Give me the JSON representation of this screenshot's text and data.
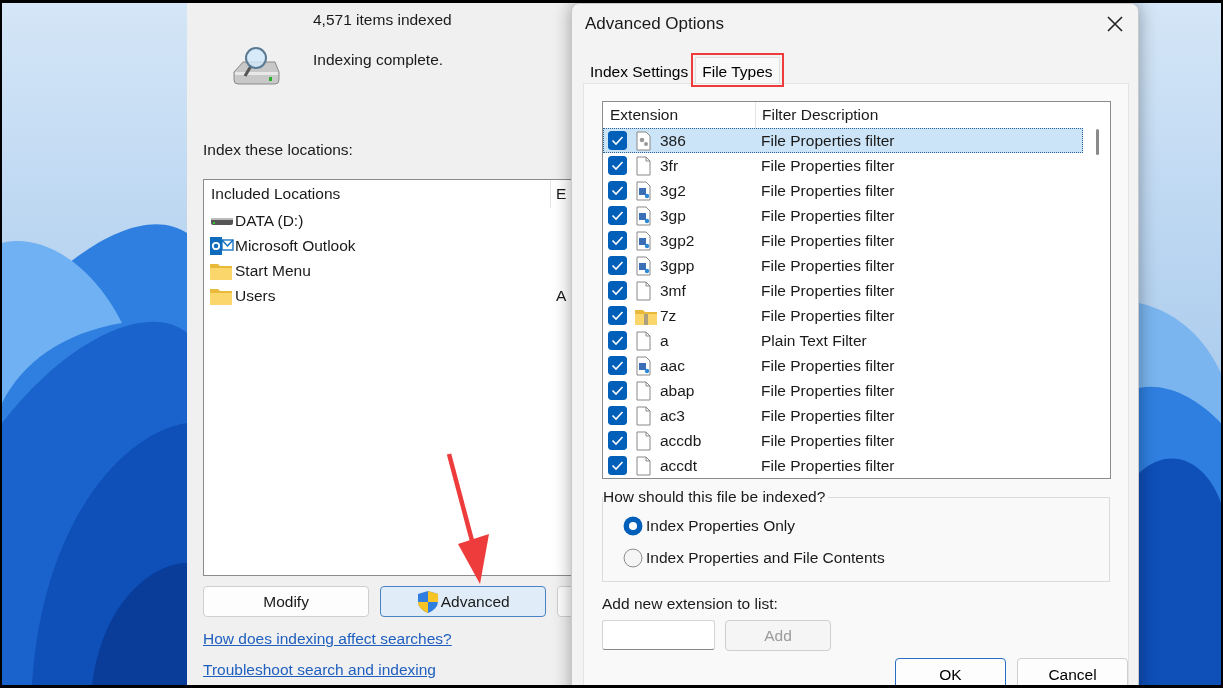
{
  "indexing_window": {
    "items_indexed": "4,571 items indexed",
    "status": "Indexing complete.",
    "locations_label": "Index these locations:",
    "locations_table": {
      "columns": [
        "Included Locations",
        "E"
      ],
      "rows": [
        {
          "kind": "drive",
          "location": "DATA (D:)"
        },
        {
          "kind": "outlook",
          "location": "Microsoft Outlook"
        },
        {
          "kind": "folder",
          "location": "Start Menu"
        },
        {
          "kind": "folder",
          "location": "Users",
          "column_2": "A"
        }
      ]
    },
    "buttons": [
      {
        "label": "Modify",
        "shield": false,
        "focused": false
      },
      {
        "label": "Advanced",
        "shield": true,
        "focused": true
      }
    ],
    "callout_arrow": true,
    "links": [
      "How does indexing affect searches?",
      "Troubleshoot search and indexing"
    ]
  },
  "advanced_options": {
    "title": "Advanced Options",
    "tabs": [
      {
        "label": "Index Settings",
        "selected": false,
        "highlighted": false
      },
      {
        "label": "File Types",
        "selected": true,
        "highlighted": true
      }
    ],
    "file_types": {
      "columns": [
        "Extension",
        "Filter Description"
      ],
      "rows": [
        {
          "kind": "gear",
          "extension": "386",
          "description": "File Properties filter",
          "checked": true,
          "selected": true
        },
        {
          "kind": "blank",
          "extension": "3fr",
          "description": "File Properties filter",
          "checked": true,
          "selected": false
        },
        {
          "kind": "media",
          "extension": "3g2",
          "description": "File Properties filter",
          "checked": true,
          "selected": false
        },
        {
          "kind": "media",
          "extension": "3gp",
          "description": "File Properties filter",
          "checked": true,
          "selected": false
        },
        {
          "kind": "media",
          "extension": "3gp2",
          "description": "File Properties filter",
          "checked": true,
          "selected": false
        },
        {
          "kind": "media",
          "extension": "3gpp",
          "description": "File Properties filter",
          "checked": true,
          "selected": false
        },
        {
          "kind": "blank",
          "extension": "3mf",
          "description": "File Properties filter",
          "checked": true,
          "selected": false
        },
        {
          "kind": "zip",
          "extension": "7z",
          "description": "File Properties filter",
          "checked": true,
          "selected": false
        },
        {
          "kind": "blank",
          "extension": "a",
          "description": "Plain Text Filter",
          "checked": true,
          "selected": false
        },
        {
          "kind": "media",
          "extension": "aac",
          "description": "File Properties filter",
          "checked": true,
          "selected": false
        },
        {
          "kind": "blank",
          "extension": "abap",
          "description": "File Properties filter",
          "checked": true,
          "selected": false
        },
        {
          "kind": "blank",
          "extension": "ac3",
          "description": "File Properties filter",
          "checked": true,
          "selected": false
        },
        {
          "kind": "blank",
          "extension": "accdb",
          "description": "File Properties filter",
          "checked": true,
          "selected": false
        },
        {
          "kind": "blank",
          "extension": "accdt",
          "description": "File Properties filter",
          "checked": true,
          "selected": false
        }
      ]
    },
    "index_group": {
      "title": "How should this file be indexed?",
      "options": [
        {
          "label": "Index Properties Only",
          "selected": true
        },
        {
          "label": "Index Properties and File Contents",
          "selected": false
        }
      ]
    },
    "add_label": "Add new extension to list:",
    "add_button": {
      "label": "Add",
      "disabled": true
    },
    "buttons": [
      "OK",
      "Cancel"
    ]
  }
}
